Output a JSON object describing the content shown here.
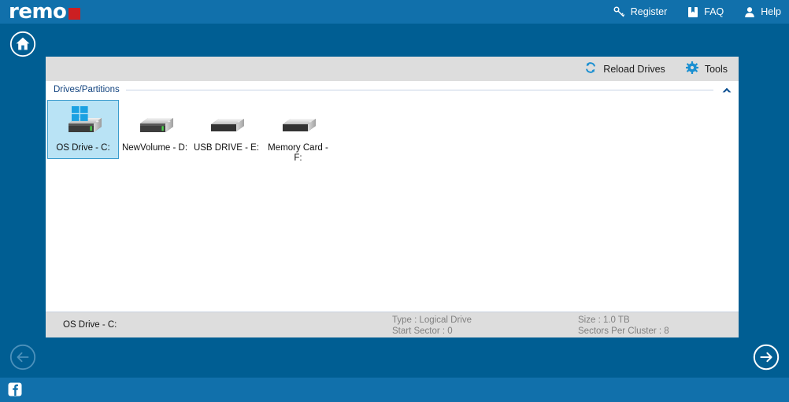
{
  "app": {
    "logo_text": "remo",
    "accent_blue": "#1170ab",
    "body_blue": "#005e93",
    "logo_red": "#cc1f22",
    "panel_gray": "#dddddd",
    "selection_fill": "#b9e3f5",
    "selection_border": "#3b9ccd"
  },
  "header": {
    "links": [
      {
        "label": "Register",
        "icon": "key-icon"
      },
      {
        "label": "FAQ",
        "icon": "book-icon"
      },
      {
        "label": "Help",
        "icon": "person-icon"
      }
    ]
  },
  "home": {
    "icon": "home-icon"
  },
  "toolbar": {
    "reload_label": "Reload Drives",
    "reload_icon": "refresh-icon",
    "tools_label": "Tools",
    "tools_icon": "gear-icon"
  },
  "drives_group": {
    "title": "Drives/Partitions",
    "collapse_icon": "chevron-up-icon"
  },
  "drives": [
    {
      "label": "OS Drive - C:",
      "icon": "hard-drive-windows-icon",
      "selected": true
    },
    {
      "label": "NewVolume - D:",
      "icon": "hard-drive-icon",
      "selected": false
    },
    {
      "label": "USB DRIVE - E:",
      "icon": "usb-drive-icon",
      "selected": false
    },
    {
      "label": "Memory Card - F:",
      "icon": "memory-card-icon",
      "selected": false
    }
  ],
  "status": {
    "name": "OS Drive - C:",
    "type_line": "Type : Logical Drive",
    "start_sector_line": "Start Sector : 0",
    "size_line": "Size : 1.0 TB",
    "sectors_per_cluster_line": "Sectors Per Cluster : 8"
  },
  "navigation": {
    "back_icon": "arrow-left-circle-icon",
    "next_icon": "arrow-right-circle-icon"
  },
  "footer": {
    "facebook_icon": "facebook-icon"
  }
}
